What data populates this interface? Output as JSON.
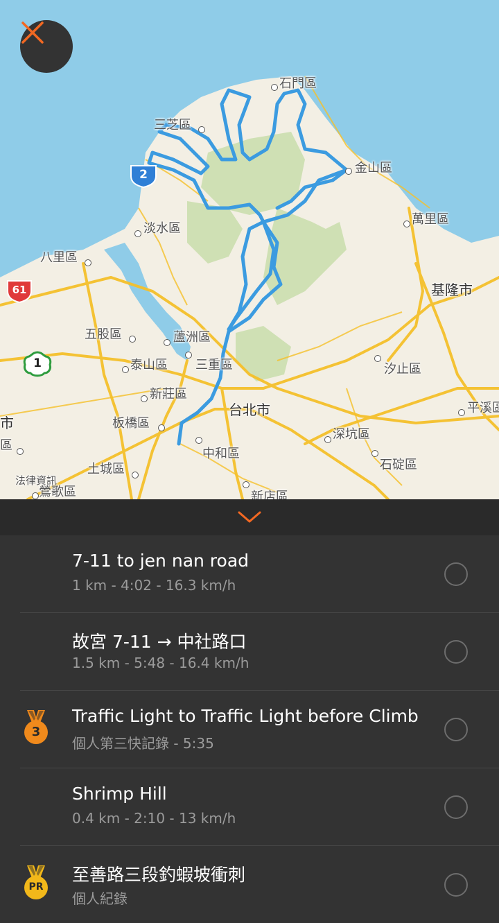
{
  "map": {
    "labels": {
      "shimen": "石門區",
      "sanzhi": "三芝區",
      "jinshan": "金山區",
      "wanli": "萬里區",
      "tamsui": "淡水區",
      "bali": "八里區",
      "keelung": "基隆市",
      "wugu": "五股區",
      "luzhou": "蘆洲區",
      "taishan": "泰山區",
      "sanchong": "三重區",
      "xizhi": "汐止區",
      "xinzhuang": "新莊區",
      "taipei": "台北市",
      "pingxi": "平溪區",
      "banqiao": "板橋區",
      "shenkeng": "深坑區",
      "zhonghe": "中和區",
      "shiding": "石碇區",
      "tucheng": "土城區",
      "fazhi": "法律資訊",
      "yingge": "鶯歌區",
      "xindian": "新店區",
      "edge_shi": "市",
      "edge_qu": "區"
    },
    "shields": {
      "route2": "2",
      "route61": "61",
      "route1": "1"
    },
    "colors": {
      "sea": "#8fcce8",
      "land": "#f3efe4",
      "park": "#cfe0b4",
      "road": "#f5c02b",
      "route": "#3b9be0"
    }
  },
  "close_button": {
    "icon": "close-icon",
    "color": "#f26822"
  },
  "collapse": {
    "icon": "chevron-down-icon",
    "color": "#f26822"
  },
  "segments": [
    {
      "title": "7-11 to jen nan road",
      "subtitle": "1 km - 4:02 - 16.3 km/h",
      "medal": ""
    },
    {
      "title": "故宮 7-11 → 中社路口",
      "subtitle": "1.5 km - 5:48 - 16.4 km/h",
      "medal": ""
    },
    {
      "title": "Traffic Light to Traffic Light before Climb",
      "subtitle": "個人第三快記錄 - 5:35",
      "medal": "3"
    },
    {
      "title": "Shrimp Hill",
      "subtitle": "0.4 km - 2:10 - 13 km/h",
      "medal": ""
    },
    {
      "title": "至善路三段釣蝦坡衝刺",
      "subtitle": "個人紀錄",
      "medal": "PR"
    }
  ]
}
